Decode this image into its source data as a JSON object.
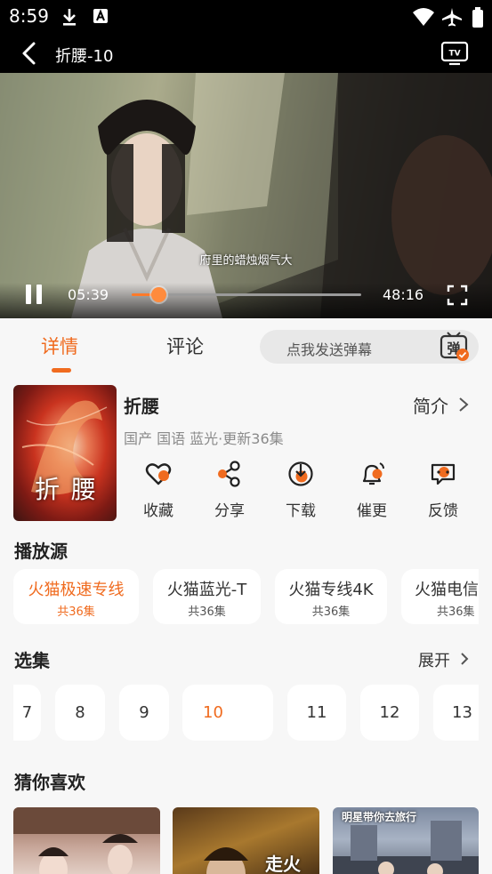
{
  "status_bar": {
    "time": "8:59",
    "icons": [
      "download-icon",
      "text-a-icon",
      "wifi-icon",
      "airplane-icon",
      "battery-icon"
    ]
  },
  "player": {
    "title": "折腰-10",
    "subtitle": "府里的蜡烛烟气大",
    "current_time": "05:39",
    "total_time": "48:16",
    "progress": 0.117
  },
  "tabs": {
    "details": "详情",
    "comments": "评论",
    "danmu_placeholder": "点我发送弹幕",
    "danmu_icon_text": "弹"
  },
  "show": {
    "title": "折腰",
    "poster_title": "折 腰",
    "meta": "国产 国语 蓝光·更新36集",
    "intro_label": "简介"
  },
  "actions": [
    {
      "label": "收藏",
      "icon": "heart-icon"
    },
    {
      "label": "分享",
      "icon": "share-icon"
    },
    {
      "label": "下载",
      "icon": "download-circle-icon"
    },
    {
      "label": "催更",
      "icon": "bell-icon"
    },
    {
      "label": "反馈",
      "icon": "feedback-icon"
    }
  ],
  "sources": {
    "section_title": "播放源",
    "items": [
      {
        "name": "火猫极速专线",
        "count": "共36集",
        "active": true
      },
      {
        "name": "火猫蓝光-T",
        "count": "共36集",
        "active": false
      },
      {
        "name": "火猫专线4K",
        "count": "共36集",
        "active": false
      },
      {
        "name": "火猫电信",
        "count": "共36集",
        "active": false
      }
    ]
  },
  "episodes": {
    "section_title": "选集",
    "expand_label": "展开",
    "items": [
      "7",
      "8",
      "9",
      "10",
      "11",
      "12",
      "13"
    ],
    "active": "10"
  },
  "recommend": {
    "section_title": "猜你喜欢",
    "card2_text": "走火",
    "card3_text": "明星带你去旅行"
  },
  "colors": {
    "accent": "#f06b1f",
    "background": "#f7f7f7",
    "card": "#ffffff"
  }
}
